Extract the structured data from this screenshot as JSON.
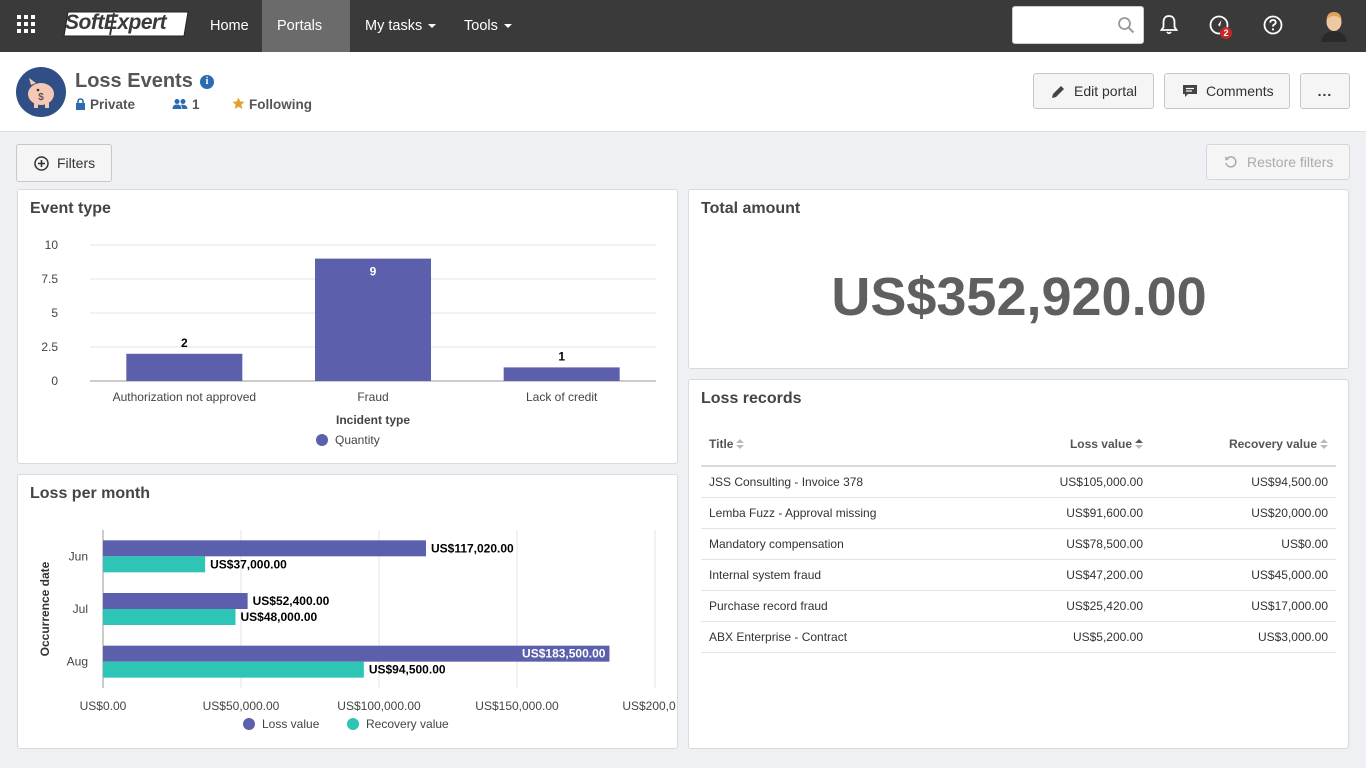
{
  "nav": {
    "logo": "SoftExpert",
    "items": [
      {
        "label": "Home",
        "dropdown": false,
        "active": false
      },
      {
        "label": "Portals",
        "dropdown": true,
        "active": true
      },
      {
        "label": "My tasks",
        "dropdown": true,
        "active": false
      },
      {
        "label": "Tools",
        "dropdown": true,
        "active": false
      }
    ],
    "search_placeholder": "",
    "icons": [
      "apps-grid-icon",
      "search-icon",
      "bell-icon",
      "compass-icon",
      "help-icon",
      "user-avatar"
    ],
    "notification_badge": "2"
  },
  "header": {
    "title": "Loss Events",
    "privacy": "Private",
    "members": "1",
    "following": "Following",
    "edit_button": "Edit portal",
    "comments_button": "Comments",
    "more_button": "..."
  },
  "toolbar": {
    "filters_button": "Filters",
    "restore_button": "Restore filters"
  },
  "event_type": {
    "title": "Event type",
    "chart_data": {
      "type": "bar",
      "categories": [
        "Authorization not approved",
        "Fraud",
        "Lack of credit"
      ],
      "series": [
        {
          "name": "Quantity",
          "values": [
            2,
            9,
            1
          ]
        }
      ],
      "xlabel": "Incident type",
      "ylabel": "",
      "ylim": [
        0,
        10
      ],
      "yticks": [
        "0",
        "2.5",
        "5",
        "7.5",
        "10"
      ],
      "grid": true,
      "legend": "bottom"
    }
  },
  "total_amount": {
    "title": "Total amount",
    "value": "US$352,920.00"
  },
  "loss_per_month": {
    "title": "Loss per month",
    "chart_data": {
      "type": "bar",
      "orientation": "horizontal",
      "categories": [
        "Jun",
        "Jul",
        "Aug"
      ],
      "series": [
        {
          "name": "Loss value",
          "values": [
            117020,
            52400,
            183500
          ],
          "labels": [
            "US$117,020.00",
            "US$52,400.00",
            "US$183,500.00"
          ],
          "color": "#5b5fac"
        },
        {
          "name": "Recovery value",
          "values": [
            37000,
            48000,
            94500
          ],
          "labels": [
            "US$37,000.00",
            "US$48,000.00",
            "US$94,500.00"
          ],
          "color": "#2ec4b6"
        }
      ],
      "ylabel": "Occurrence date",
      "xlim": [
        0,
        200000
      ],
      "xticks": [
        "US$0.00",
        "US$50,000.00",
        "US$100,000.00",
        "US$150,000.00",
        "US$200,0…"
      ],
      "grid": true,
      "legend": "bottom"
    }
  },
  "loss_records": {
    "title": "Loss records",
    "columns": [
      "Title",
      "Loss value",
      "Recovery value"
    ],
    "rows": [
      [
        "JSS Consulting - Invoice 378",
        "US$105,000.00",
        "US$94,500.00"
      ],
      [
        "Lemba Fuzz - Approval missing",
        "US$91,600.00",
        "US$20,000.00"
      ],
      [
        "Mandatory compensation",
        "US$78,500.00",
        "US$0.00"
      ],
      [
        "Internal system fraud",
        "US$47,200.00",
        "US$45,000.00"
      ],
      [
        "Purchase record fraud",
        "US$25,420.00",
        "US$17,000.00"
      ],
      [
        "ABX Enterprise - Contract",
        "US$5,200.00",
        "US$3,000.00"
      ]
    ]
  },
  "colors": {
    "topbar": "#3a3a3a",
    "bar_primary": "#5b5fac",
    "bar_secondary": "#2ec4b6",
    "info_blue": "#2b6cb0",
    "star": "#e0a030"
  }
}
